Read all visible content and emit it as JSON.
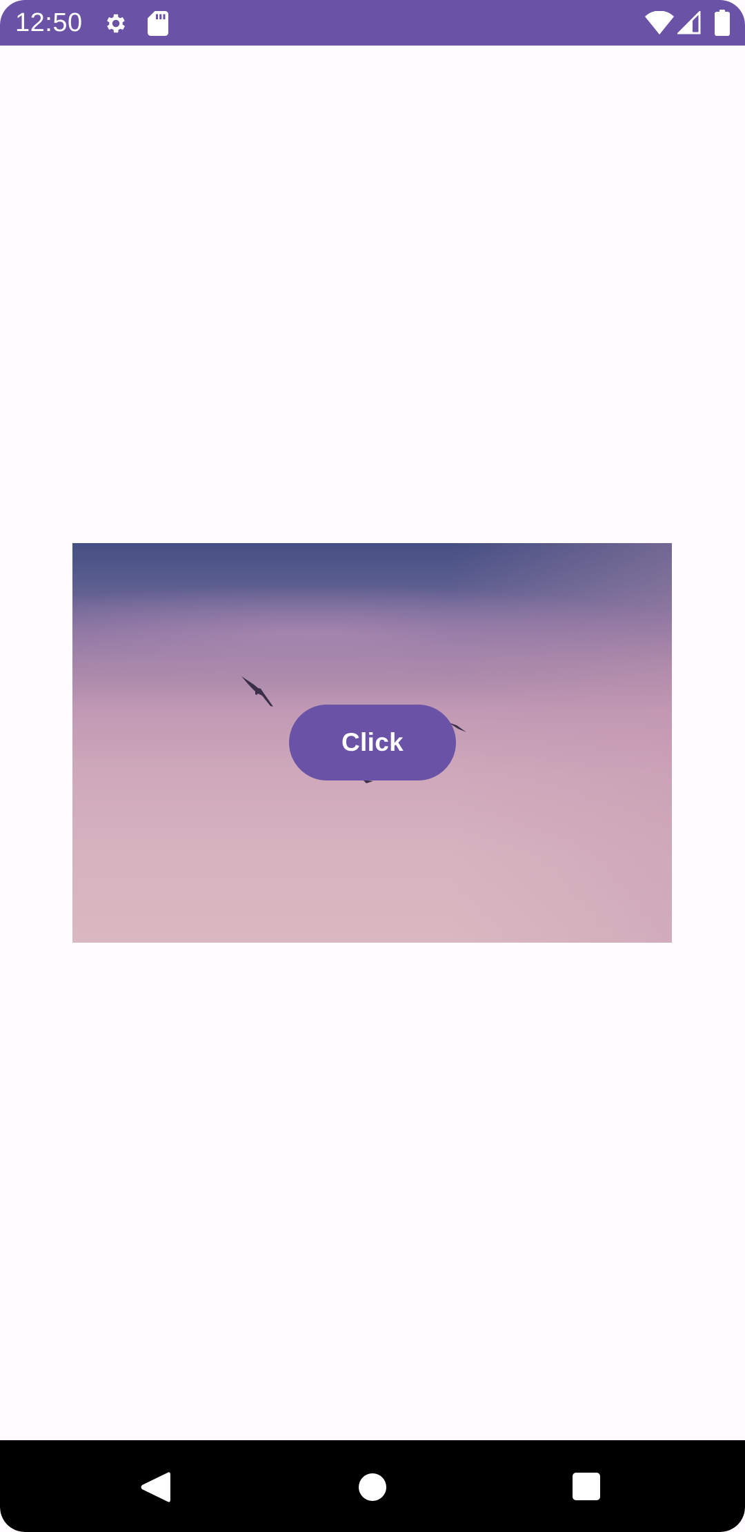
{
  "status_bar": {
    "time": "12:50",
    "icons": [
      "gear-icon",
      "sd-card-icon",
      "wifi-icon",
      "cellular-signal-icon",
      "battery-icon"
    ],
    "background": "#6a52a6"
  },
  "main": {
    "image": {
      "description_icon": "birds-sky-photo"
    },
    "button": {
      "label": "Click",
      "color": "#6a52a6"
    }
  },
  "nav_bar": {
    "icons": [
      "back-icon",
      "home-icon",
      "recents-icon"
    ],
    "background": "#000000"
  }
}
